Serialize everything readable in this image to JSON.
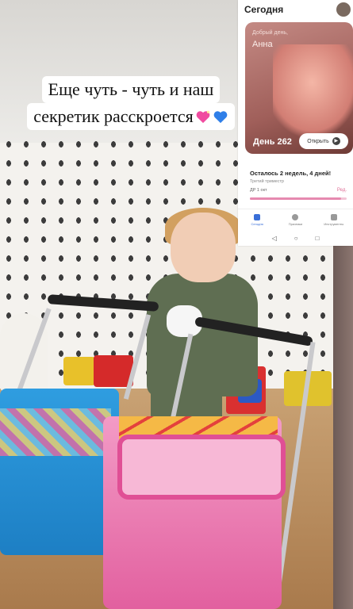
{
  "caption": {
    "line1": "Еще чуть - чуть и наш",
    "line2": "секретик расскроется",
    "emoji": [
      "sparkling-heart",
      "blue-heart"
    ]
  },
  "phone": {
    "header": "Сегодня",
    "card": {
      "greeting": "Добрый день,",
      "name": "Анна",
      "day": "День 262",
      "open_button": "Открыть",
      "open_icon": "play-icon"
    },
    "progress": {
      "remaining": "Осталось 2 недель, 4 дней!",
      "trimester": "Третий триместр",
      "due_date": "ДР 1 окт",
      "ready": "Ред.",
      "fraction": 0.94
    },
    "nav": [
      {
        "label": "Сегодня",
        "icon": "calendar-icon",
        "active": true
      },
      {
        "label": "Признаки",
        "icon": "compass-icon",
        "active": false
      },
      {
        "label": "Инструменты",
        "icon": "briefcase-icon",
        "active": false
      }
    ],
    "system_nav": [
      "◁",
      "○",
      "□"
    ]
  },
  "colors": {
    "accent_pink": "#e68ab0",
    "nav_active": "#3a6fd8",
    "heart_pink": "#f04ca0",
    "heart_blue": "#2f7fe8"
  }
}
